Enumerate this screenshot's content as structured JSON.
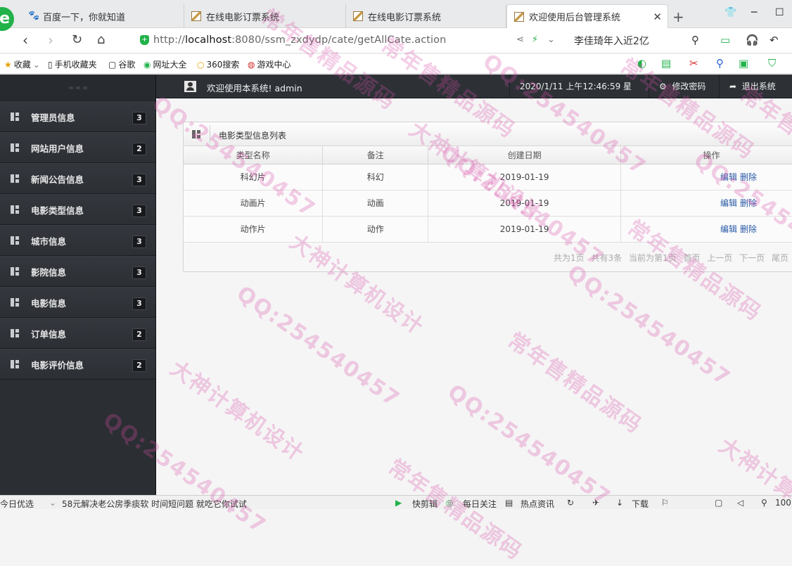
{
  "browser": {
    "tabs": [
      {
        "title": "百度一下，你就知道",
        "icon": "baidu-paw-icon"
      },
      {
        "title": "在线电影订票系统",
        "icon": "film-page-icon"
      },
      {
        "title": "在线电影订票系统",
        "icon": "film-page-icon"
      },
      {
        "title": "欢迎使用后台管理系统",
        "icon": "film-page-icon"
      }
    ],
    "url_prefix": "http://",
    "url_host": "localhost",
    "url_rest": ":8080/ssm_zxdydp/cate/getAllCate.action",
    "search_hint": "李佳琦年入近2亿",
    "bookmarks": [
      "收藏",
      "手机收藏夹",
      "谷歌",
      "网址大全",
      "360搜索",
      "游戏中心"
    ]
  },
  "topbar": {
    "welcome": "欢迎使用本系统! admin",
    "datetime": "2020/1/11 上午12:46:59 星期六",
    "change_password": "修改密码",
    "logout": "退出系统"
  },
  "sidebar": {
    "items": [
      {
        "label": "管理员信息",
        "count": "3"
      },
      {
        "label": "网站用户信息",
        "count": "2"
      },
      {
        "label": "新闻公告信息",
        "count": "3"
      },
      {
        "label": "电影类型信息",
        "count": "3"
      },
      {
        "label": "城市信息",
        "count": "3"
      },
      {
        "label": "影院信息",
        "count": "3"
      },
      {
        "label": "电影信息",
        "count": "3"
      },
      {
        "label": "订单信息",
        "count": "2"
      },
      {
        "label": "电影评价信息",
        "count": "2"
      }
    ]
  },
  "panel": {
    "title": "电影类型信息列表",
    "columns": [
      "类型名称",
      "备注",
      "创建日期",
      "操作"
    ],
    "edit_label": "编辑",
    "delete_label": "删除",
    "rows": [
      {
        "name": "科幻片",
        "memo": "科幻",
        "date": "2019-01-19"
      },
      {
        "name": "动画片",
        "memo": "动画",
        "date": "2019-01-19"
      },
      {
        "name": "动作片",
        "memo": "动作",
        "date": "2019-01-19"
      }
    ],
    "pager": {
      "total_pages": "共为1页",
      "total_rows": "共有3条",
      "current": "当前为第1页",
      "first": "首页",
      "prev": "上一页",
      "next": "下一页",
      "last": "尾页"
    }
  },
  "status": {
    "left_text": "今日优选",
    "news": "58元解决老公房季痰软 时间短问题 就吃它你试试",
    "items": [
      "快剪辑",
      "每日关注",
      "热点资讯",
      "下载"
    ],
    "zoom": "100"
  },
  "watermark": {
    "lines": [
      "大神计算机设计",
      "QQ:254540457",
      "常年售精品源码"
    ]
  },
  "colors": {
    "sidebar_bg": "#2b2e33",
    "topbar_bg": "#2d3136",
    "link": "#2a5aa6",
    "browser_green": "#21b24a"
  }
}
